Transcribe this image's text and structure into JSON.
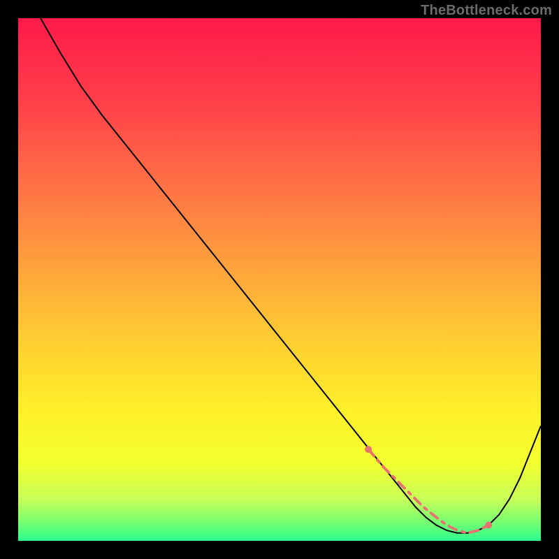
{
  "watermark": "TheBottleneck.com",
  "chart_data": {
    "type": "line",
    "title": "",
    "xlabel": "",
    "ylabel": "",
    "xlim": [
      0,
      100
    ],
    "ylim": [
      0,
      100
    ],
    "series": [
      {
        "name": "curve",
        "x": [
          0,
          4,
          8,
          12,
          16,
          20,
          24,
          28,
          32,
          36,
          40,
          44,
          48,
          52,
          56,
          60,
          64,
          68,
          70,
          72,
          74,
          76,
          78,
          80,
          82,
          84,
          86,
          88,
          90,
          92,
          94,
          96,
          100
        ],
        "y": [
          108,
          100.5,
          93.5,
          87,
          81.5,
          76.5,
          71.5,
          66.5,
          61.5,
          56.5,
          51.5,
          46.5,
          41.5,
          36.5,
          31.5,
          26.5,
          21.5,
          16.5,
          14,
          11.5,
          9,
          6.5,
          4.5,
          3,
          2,
          1.5,
          1.5,
          2,
          3,
          5,
          8,
          12,
          22
        ],
        "color": "#000000",
        "stroke_width": 2
      },
      {
        "name": "highlight-band",
        "x": [
          67,
          70,
          72.5,
          75,
          77.5,
          80,
          82,
          84,
          86,
          88,
          90
        ],
        "y": [
          17.5,
          14,
          11.5,
          9,
          6.5,
          4.5,
          3,
          2,
          1.5,
          2,
          3
        ],
        "color": "#e77471",
        "stroke_width": 4,
        "style": "dashed",
        "endpoint_markers": true
      }
    ],
    "background": {
      "type": "vertical-gradient",
      "stops": [
        {
          "offset": 0.0,
          "color": "#ff1a49"
        },
        {
          "offset": 0.15,
          "color": "#ff3c4a"
        },
        {
          "offset": 0.3,
          "color": "#ff6b46"
        },
        {
          "offset": 0.45,
          "color": "#ff9a3e"
        },
        {
          "offset": 0.6,
          "color": "#ffc933"
        },
        {
          "offset": 0.75,
          "color": "#fff029"
        },
        {
          "offset": 0.85,
          "color": "#f4ff2e"
        },
        {
          "offset": 0.92,
          "color": "#c8ff58"
        },
        {
          "offset": 0.96,
          "color": "#7fff6e"
        },
        {
          "offset": 1.0,
          "color": "#2bff8f"
        }
      ]
    }
  }
}
